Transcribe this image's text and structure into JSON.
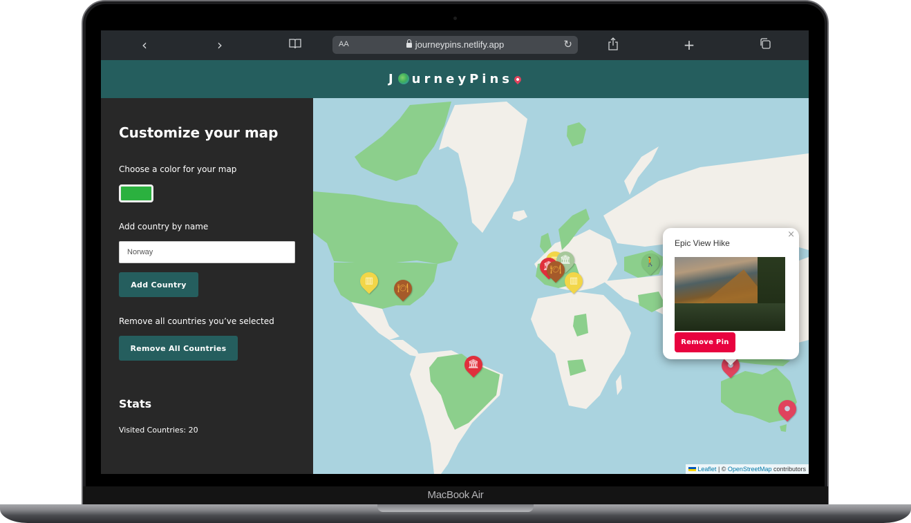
{
  "device": {
    "label": "MacBook Air"
  },
  "browser": {
    "back_icon": "chevron-left",
    "forward_icon": "chevron-right",
    "bookmarks_icon": "book-open",
    "text_size_label": "AA",
    "url": "journeypins.netlify.app",
    "reload_icon": "reload",
    "share_icon": "share",
    "new_tab_icon": "plus",
    "tabs_icon": "tabs",
    "glyphs": {
      "back": "‹",
      "forward": "›",
      "bookmarks": "📖",
      "reload": "↻",
      "share": "⇪",
      "new_tab": "+",
      "tabs": "❐"
    }
  },
  "header": {
    "logo_prefix": "J",
    "logo_suffix": "urneyPins",
    "brand_color": "#255e5e"
  },
  "sidebar": {
    "title": "Customize your map",
    "color_label": "Choose a color for your map",
    "selected_color": "#2bb13f",
    "add_label": "Add country by name",
    "country_input_value": "Norway",
    "add_button": "Add Country",
    "remove_label": "Remove all countries you’ve selected",
    "remove_button": "Remove All Countries",
    "stats_title": "Stats",
    "visited_countries_label": "Visited Countries: 20",
    "visited_countries_count": 20
  },
  "map": {
    "ocean_color": "#aad3df",
    "land_color": "#f2efe9",
    "visited_color": "#8ccf8c",
    "visited_countries_shown": [
      "Canada",
      "United States",
      "Brazil",
      "Svalbard/Norway",
      "United Kingdom",
      "France",
      "Spain",
      "Italy",
      "Germany",
      "Kazakhstan",
      "Chad",
      "Angola",
      "Iran",
      "Australia",
      "Indonesia",
      "Mexico"
    ],
    "markers": [
      {
        "name": "tower-marker-usa",
        "color": "#f2d648",
        "glyph": "▥"
      },
      {
        "name": "food-marker-usa",
        "color": "#a55a2a",
        "glyph": "🍽"
      },
      {
        "name": "museum-marker-brazil",
        "color": "#e0303c",
        "glyph": "🏛"
      },
      {
        "name": "tower-marker-france",
        "color": "#f2d648",
        "glyph": "▥"
      },
      {
        "name": "museum-marker-france",
        "color": "#e0303c",
        "glyph": "🏛"
      },
      {
        "name": "monument-marker-germany",
        "color": "#a6c89a",
        "glyph": "🏛"
      },
      {
        "name": "food-marker-spain",
        "color": "#a55a2a",
        "glyph": "🍽"
      },
      {
        "name": "tower-marker-italy",
        "color": "#f2d648",
        "glyph": "▥"
      },
      {
        "name": "hike-marker-kazakhstan",
        "color": "#7fc27a",
        "glyph": "🚶"
      },
      {
        "name": "location-marker-indonesia",
        "color": "#e0435d",
        "glyph": "●"
      },
      {
        "name": "location-marker-australia",
        "color": "#e0435d",
        "glyph": "●"
      }
    ],
    "popup": {
      "title": "Epic View Hike",
      "close_glyph": "×",
      "image_alt": "mountain landscape photo",
      "remove_button": "Remove Pin",
      "remove_color": "#e8033f"
    },
    "attribution": {
      "leaflet": "Leaflet",
      "separator": " | © ",
      "osm": "OpenStreetMap",
      "suffix": " contributors"
    }
  }
}
